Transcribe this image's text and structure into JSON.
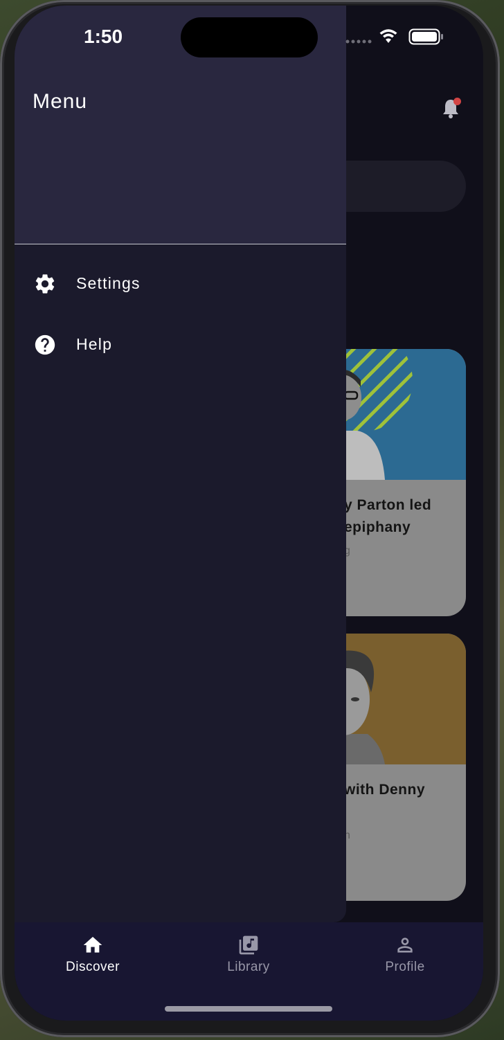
{
  "status_bar": {
    "time": "1:50"
  },
  "drawer": {
    "title": "Menu",
    "items": [
      {
        "label": "Settings",
        "icon": "gear-icon"
      },
      {
        "label": "Help",
        "icon": "help-circle-icon"
      }
    ]
  },
  "background_content": {
    "cards": [
      {
        "title": "y Parton led\nepiphany",
        "meta": "g"
      },
      {
        "title": "with Denny",
        "meta": "n"
      }
    ]
  },
  "bottom_nav": {
    "items": [
      {
        "label": "Discover",
        "icon": "home-icon",
        "active": true
      },
      {
        "label": "Library",
        "icon": "music-library-icon",
        "active": false
      },
      {
        "label": "Profile",
        "icon": "person-icon",
        "active": false
      }
    ]
  },
  "colors": {
    "drawer_bg": "#1b1a2c",
    "drawer_header_bg": "#29273f",
    "bottom_nav_bg": "#181632",
    "notification_dot": "#d24545",
    "card1_image_bg": "#2c6a92",
    "card2_image_bg": "#7a5f2e"
  }
}
